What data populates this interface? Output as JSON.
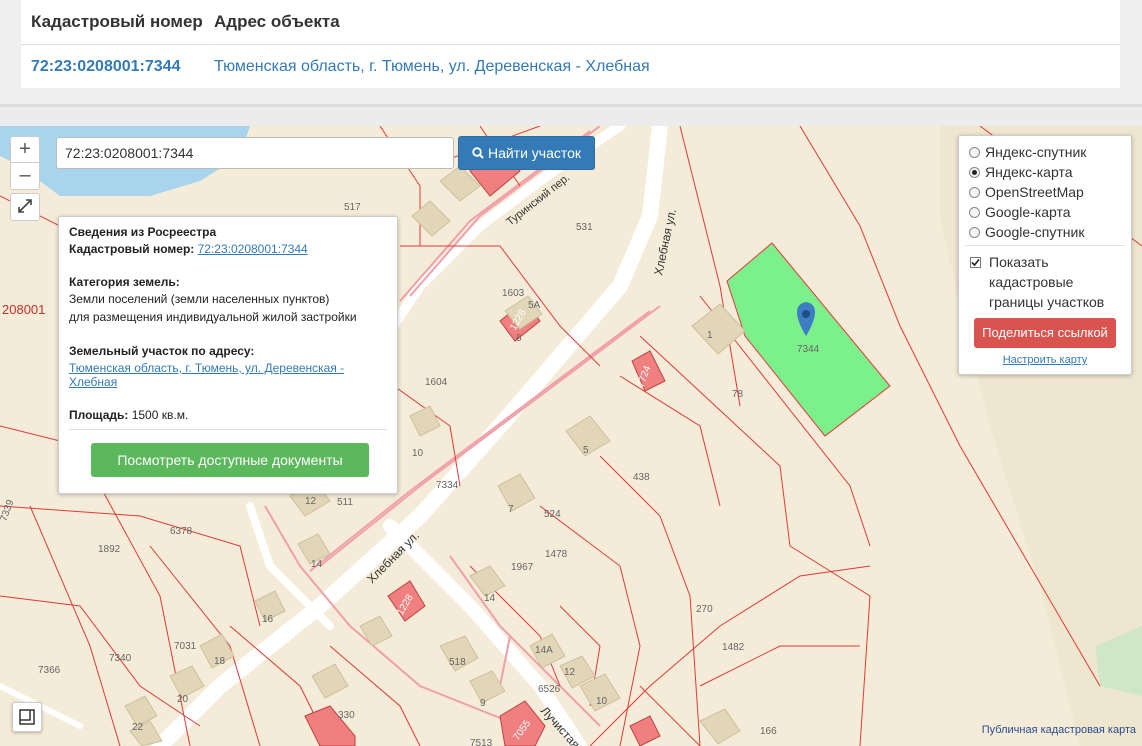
{
  "table": {
    "col_cadastral": "Кадастровый номер",
    "col_address": "Адрес объекта",
    "row_cadastral": "72:23:0208001:7344",
    "row_address": "Тюменская область, г. Тюмень, ул. Деревенская - Хлебная"
  },
  "map": {
    "zoom_in": "+",
    "zoom_out": "–",
    "search_value": "72:23:0208001:7344",
    "find_label": "Найти участок",
    "parcel_label": "7344",
    "block_label": "208001",
    "copyright": "Публичная кадастровая карта",
    "colors": {
      "parcel_fill": "#7cf08a",
      "boundary": "#e03a3a",
      "road": "#ffffff",
      "marker": "#3d7dc4"
    }
  },
  "info": {
    "title": "Сведения из Росреестра",
    "cad_label": "Кадастровый номер:",
    "cad_value": "72:23:0208001:7344",
    "cat_label": "Категория земель:",
    "cat_line1": "Земли поселений (земли населенных пунктов)",
    "cat_line2": "для размещения индивидуальной жилой застройки",
    "addr_label": "Земельный участок по адресу:",
    "addr_line1": "Тюменская область, г. Тюмень, ул. Деревенская -",
    "addr_line2": "Хлебная",
    "area_label": "Площадь:",
    "area_value": "1500 кв.м.",
    "docs_button": "Посмотреть доступные документы"
  },
  "layers": {
    "options": [
      "Яндекс-спутник",
      "Яндекс-карта",
      "OpenStreetMap",
      "Google-карта",
      "Google-спутник"
    ],
    "selected": "Яндекс-карта",
    "show_bounds_1": "Показать",
    "show_bounds_2": "кадастровые",
    "show_bounds_3": "границы участков",
    "share": "Поделиться ссылкой",
    "configure": "Настроить карту"
  },
  "map_labels": {
    "streets": [
      "Хлебная ул.",
      "Хлебная ул.",
      "Лучистая",
      "Туринский пер."
    ],
    "parcels": [
      "517",
      "531",
      "1603",
      "1604",
      "78",
      "438",
      "7334",
      "511",
      "524",
      "6378",
      "1892",
      "1478",
      "1967",
      "7339",
      "270",
      "1482",
      "7031",
      "7340",
      "7366",
      "518",
      "6526",
      "330",
      "166",
      "7513"
    ],
    "houses": [
      "1",
      "5",
      "6",
      "5А",
      "10",
      "12",
      "7",
      "14",
      "14",
      "16",
      "18",
      "20",
      "22",
      "14А",
      "12",
      "9",
      "10"
    ],
    "buildings": [
      "1228",
      "7724",
      "1228",
      "7055"
    ]
  }
}
